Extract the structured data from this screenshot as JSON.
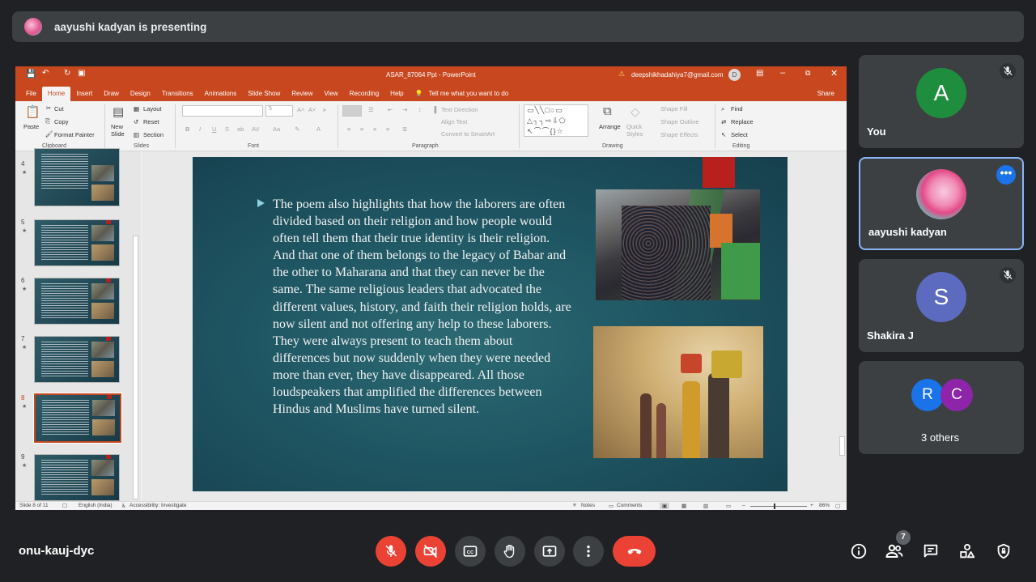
{
  "presenting_banner": {
    "text": "aayushi kadyan is presenting"
  },
  "powerpoint": {
    "title": "ASAR_87064 Ppt  -  PowerPoint",
    "account_email": "deepshikhadahiya7@gmail.com",
    "account_initial": "D",
    "tabs": [
      "File",
      "Home",
      "Insert",
      "Draw",
      "Design",
      "Transitions",
      "Animations",
      "Slide Show",
      "Review",
      "View",
      "Recording",
      "Help"
    ],
    "active_tab": "Home",
    "tell_me": "Tell me what you want to do",
    "share": "Share",
    "ribbon": {
      "clipboard": {
        "paste": "Paste",
        "cut": "Cut",
        "copy": "Copy",
        "format_painter": "Format Painter",
        "label": "Clipboard"
      },
      "slides": {
        "new_slide": "New Slide",
        "layout": "Layout",
        "reset": "Reset",
        "section": "Section",
        "label": "Slides"
      },
      "font": {
        "label": "Font",
        "bold": "B",
        "italic": "I",
        "underline": "U",
        "strike": "S",
        "size": "5"
      },
      "paragraph": {
        "label": "Paragraph",
        "text_direction": "Text Direction",
        "align_text": "Align Text",
        "convert_smartart": "Convert to SmartArt"
      },
      "drawing": {
        "label": "Drawing",
        "arrange": "Arrange",
        "quick_styles": "Quick Styles",
        "shape_fill": "Shape Fill",
        "shape_outline": "Shape Outline",
        "shape_effects": "Shape Effects"
      },
      "editing": {
        "label": "Editing",
        "find": "Find",
        "replace": "Replace",
        "select": "Select"
      }
    },
    "thumbnails": [
      {
        "num": "4",
        "star": "★"
      },
      {
        "num": "5",
        "star": "★"
      },
      {
        "num": "6",
        "star": "★"
      },
      {
        "num": "7",
        "star": "★"
      },
      {
        "num": "8",
        "star": "★"
      },
      {
        "num": "9",
        "star": "★"
      }
    ],
    "slide_text": "The poem also highlights that how the laborers are often divided based on their religion and how people would often tell them that their true identity is their religion. And that one of them belongs to the legacy of Babar and the other to Maharana and that they can never be the same. The same religious leaders that advocated the different values, history, and faith their religion holds, are now silent and not offering any help to these laborers. They were always present to teach them about differences but now suddenly when they were needed more than ever, they have disappeared. All those loudspeakers that amplified the differences between Hindus and Muslims have turned silent.",
    "status": {
      "slide_count": "Slide 8 of 11",
      "language": "English (India)",
      "accessibility": "Accessibility: Investigate",
      "notes": "Notes",
      "comments": "Comments",
      "zoom": "86%"
    }
  },
  "participants": [
    {
      "name": "You",
      "initial": "A",
      "color": "#1e8e3e",
      "muted": true
    },
    {
      "name": "aayushi kadyan",
      "muted": false,
      "more": "•••"
    },
    {
      "name": "Shakira J",
      "initial": "S",
      "color": "#5c6bc0",
      "muted": true
    },
    {
      "name": "3 others",
      "initials": [
        "R",
        "C"
      ],
      "colors": [
        "#1a73e8",
        "#8e24aa"
      ]
    }
  ],
  "meeting": {
    "code": "onu-kauj-dyc",
    "participant_count": "7"
  },
  "colors": {
    "background": "#202124",
    "tile": "#3c4043",
    "danger": "#ea4335",
    "ppt_accent": "#c8471f"
  }
}
